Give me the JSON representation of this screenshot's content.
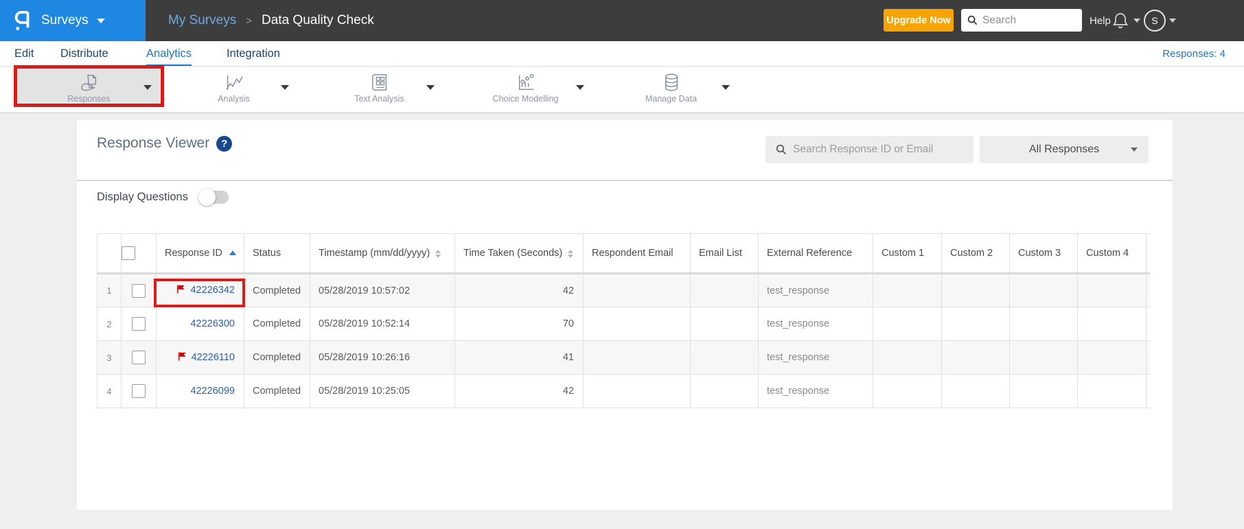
{
  "topbar": {
    "product": "Surveys",
    "breadcrumb": {
      "parent": "My Surveys",
      "separator": ">",
      "current": "Data Quality Check"
    },
    "upgrade_label": "Upgrade Now",
    "search_placeholder": "Search",
    "help_label": "Help",
    "avatar_initial": "S"
  },
  "nav": {
    "items": [
      {
        "label": "Edit"
      },
      {
        "label": "Distribute"
      },
      {
        "label": "Analytics"
      },
      {
        "label": "Integration"
      }
    ],
    "active": "Analytics",
    "responses_count": "Responses: 4"
  },
  "toolbar": {
    "items": [
      {
        "label": "Responses",
        "icon": "responses-icon",
        "active": true
      },
      {
        "label": "Analysis",
        "icon": "analysis-icon",
        "active": false
      },
      {
        "label": "Text Analysis",
        "icon": "text-analysis-icon",
        "active": false
      },
      {
        "label": "Choice Modelling",
        "icon": "choice-modelling-icon",
        "active": false
      },
      {
        "label": "Manage Data",
        "icon": "manage-data-icon",
        "active": false
      }
    ]
  },
  "viewer": {
    "title": "Response Viewer",
    "help_glyph": "?",
    "search_placeholder": "Search Response ID or Email",
    "filter_value": "All Responses",
    "display_questions_label": "Display Questions",
    "display_questions_state": "off"
  },
  "table": {
    "headers": [
      "Response ID",
      "Status",
      "Timestamp (mm/dd/yyyy)",
      "Time Taken (Seconds)",
      "Respondent Email",
      "Email List",
      "External Reference",
      "Custom 1",
      "Custom 2",
      "Custom 3",
      "Custom 4"
    ],
    "sorted_by": "Response ID",
    "rows": [
      {
        "num": "1",
        "flagged": true,
        "id": "42226342",
        "status": "Completed",
        "timestamp": "05/28/2019 10:57:02",
        "time_taken": "42",
        "respondent_email": "",
        "email_list": "",
        "external_reference": "test_response",
        "custom1": "",
        "custom2": "",
        "custom3": "",
        "custom4": ""
      },
      {
        "num": "2",
        "flagged": false,
        "id": "42226300",
        "status": "Completed",
        "timestamp": "05/28/2019 10:52:14",
        "time_taken": "70",
        "respondent_email": "",
        "email_list": "",
        "external_reference": "test_response",
        "custom1": "",
        "custom2": "",
        "custom3": "",
        "custom4": ""
      },
      {
        "num": "3",
        "flagged": true,
        "id": "42226110",
        "status": "Completed",
        "timestamp": "05/28/2019 10:26:16",
        "time_taken": "41",
        "respondent_email": "",
        "email_list": "",
        "external_reference": "test_response",
        "custom1": "",
        "custom2": "",
        "custom3": "",
        "custom4": ""
      },
      {
        "num": "4",
        "flagged": false,
        "id": "42226099",
        "status": "Completed",
        "timestamp": "05/28/2019 10:25:05",
        "time_taken": "42",
        "respondent_email": "",
        "email_list": "",
        "external_reference": "test_response",
        "custom1": "",
        "custom2": "",
        "custom3": "",
        "custom4": ""
      }
    ]
  },
  "colors": {
    "brand_blue": "#1d87e2",
    "nav_link_blue": "#2176bd",
    "upgrade_orange": "#f7a400",
    "flag_red": "#c40000",
    "annotation_red": "#dd1a1a",
    "id_link_blue": "#2b5fa5"
  }
}
